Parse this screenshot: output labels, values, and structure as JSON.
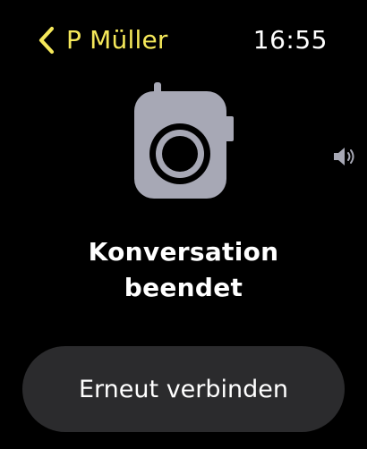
{
  "header": {
    "back_label": "P Müller",
    "time": "16:55"
  },
  "status": {
    "line1": "Konversation",
    "line2": "beendet"
  },
  "actions": {
    "reconnect_label": "Erneut verbinden"
  },
  "icons": {
    "back": "chevron-left-icon",
    "device": "walkie-talkie-icon",
    "volume": "speaker-volume-icon"
  },
  "colors": {
    "background": "#000000",
    "accent": "#f5e85a",
    "text": "#ffffff",
    "icon_gray": "#a7a8b5",
    "button_bg": "#2b2b2d"
  }
}
